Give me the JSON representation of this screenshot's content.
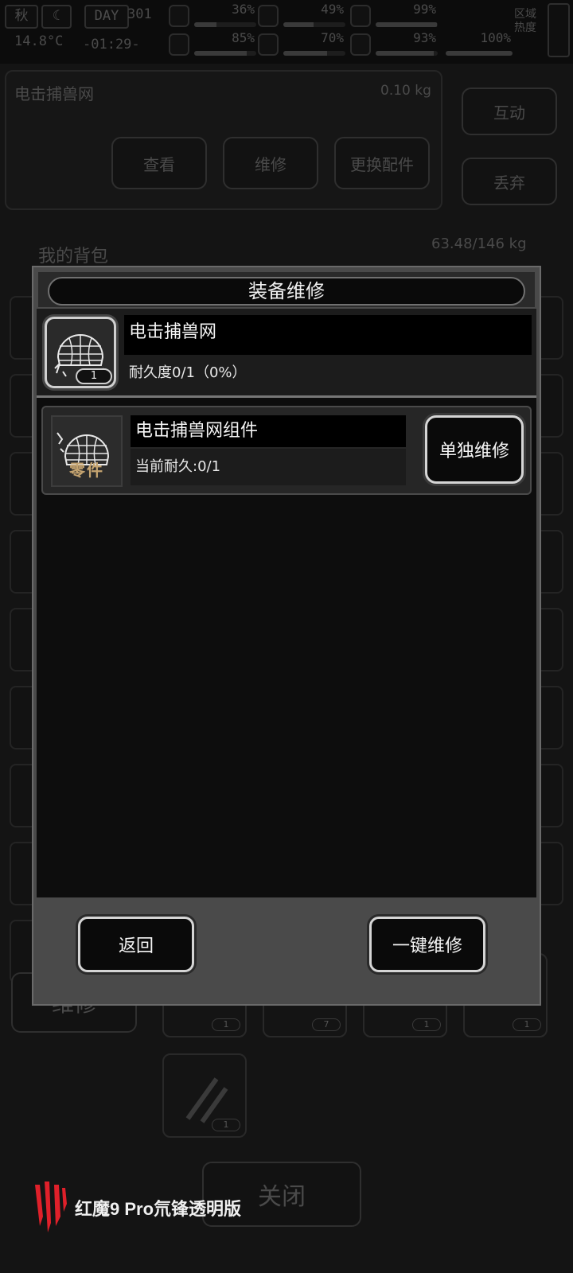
{
  "status_bar": {
    "season": "秋",
    "day_label": "DAY",
    "day_number": "301",
    "temperature": "14.8°C",
    "clock": "-01:29-",
    "stats": [
      {
        "icon": "medkit-icon",
        "value": "36%",
        "fill": 0.36
      },
      {
        "icon": "stomach-icon",
        "value": "49%",
        "fill": 0.49
      },
      {
        "icon": "battery-icon",
        "value": "99%",
        "fill": 0.99
      },
      {
        "icon": "brain-icon",
        "value": "85%",
        "fill": 0.85
      },
      {
        "icon": "water-drop-icon",
        "value": "70%",
        "fill": 0.7
      },
      {
        "icon": "heart-icon",
        "value": "93%",
        "fill": 0.93
      },
      {
        "icon": "stamina-icon",
        "value": "100%",
        "fill": 1.0
      }
    ],
    "region_label": "区域热度"
  },
  "background": {
    "item_title": "电击捕兽网",
    "item_weight": "0.10 kg",
    "interact_label": "互动",
    "discard_label": "丢弃",
    "actions": [
      "查看",
      "维修",
      "更换配件"
    ],
    "backpack_label": "我的背包",
    "backpack_weight": "63.48/146 kg",
    "repair_label": "维修",
    "slot_counts": [
      "1",
      "7",
      "1",
      "1",
      "1"
    ],
    "close_label": "关闭"
  },
  "modal": {
    "title": "装备维修",
    "item": {
      "name": "电击捕兽网",
      "durability": "耐久度0/1（0%）",
      "count": "1"
    },
    "parts": [
      {
        "name": "电击捕兽网组件",
        "tag": "零件",
        "durability": "当前耐久:0/1",
        "repair_button": "单独维修"
      }
    ],
    "back_button": "返回",
    "repair_all_button": "一键维修"
  },
  "watermark": {
    "text": "红魔9 Pro氘锋透明版"
  },
  "colors": {
    "modal_frame": "#4a4a4a",
    "panel_black": "#0d0d0d",
    "button_border": "#d5d5d5",
    "logo_red": "#e0202a",
    "part_tag": "#c5a470"
  }
}
